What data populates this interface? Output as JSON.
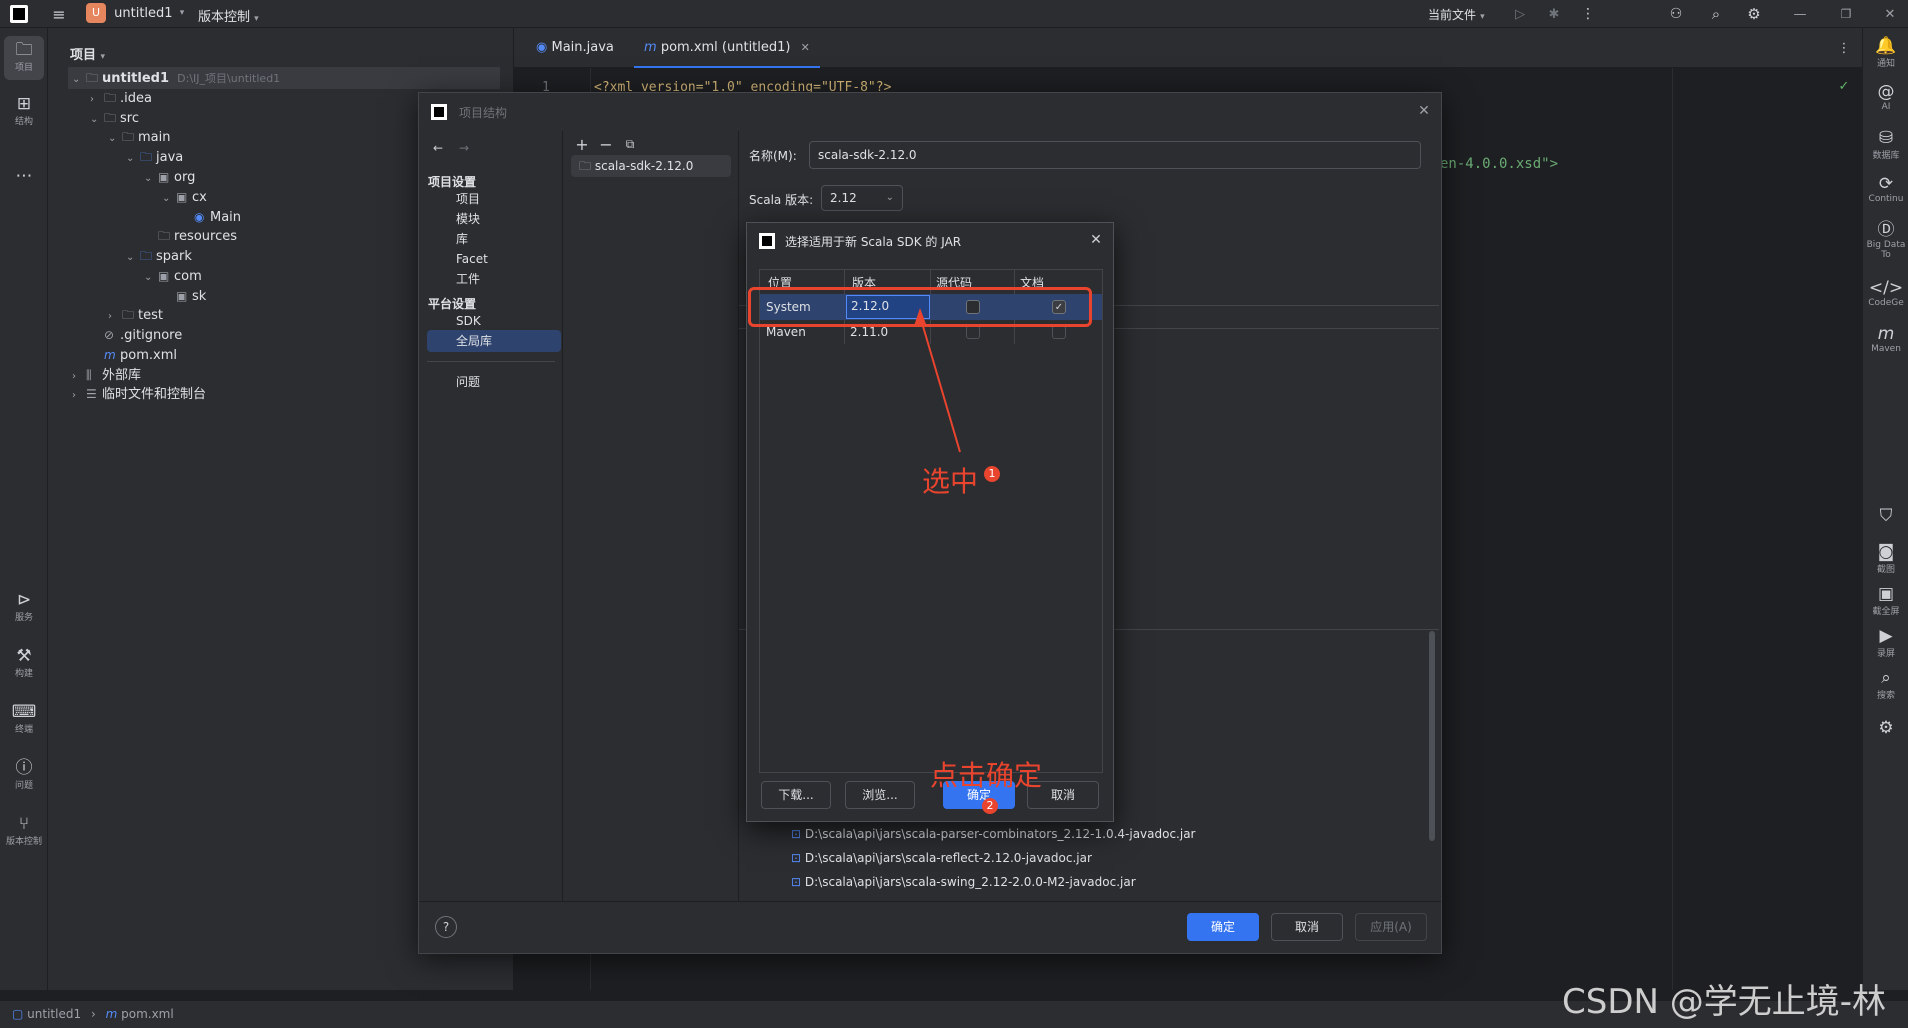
{
  "titlebar": {
    "project": "untitled1",
    "project_badge": "U",
    "vcs": "版本控制",
    "run_config": "当前文件"
  },
  "left_strip": {
    "items": [
      {
        "label": "项目",
        "icon": "folder-icon"
      },
      {
        "label": "结构",
        "icon": "structure-icon"
      },
      {
        "label": "服务",
        "icon": "services-icon"
      },
      {
        "label": "构建",
        "icon": "build-icon"
      },
      {
        "label": "终端",
        "icon": "terminal-icon"
      },
      {
        "label": "问题",
        "icon": "problems-icon"
      },
      {
        "label": "版本控制",
        "icon": "git-icon"
      }
    ]
  },
  "right_strip": {
    "items": [
      {
        "label": "通知"
      },
      {
        "label": "AI"
      },
      {
        "label": "数据库"
      },
      {
        "label": "Continu"
      },
      {
        "label": "Big Data To"
      },
      {
        "label": "CodeGe"
      },
      {
        "label": "Maven"
      },
      {
        "label": "截图"
      },
      {
        "label": "截全屏"
      },
      {
        "label": "录屏"
      },
      {
        "label": "搜索"
      }
    ]
  },
  "project_panel": {
    "title": "项目",
    "tree": [
      {
        "label": "untitled1",
        "path": "D:\\IJ_项目\\untitled1"
      },
      {
        "label": ".idea"
      },
      {
        "label": "src"
      },
      {
        "label": "main"
      },
      {
        "label": "java"
      },
      {
        "label": "org"
      },
      {
        "label": "cx"
      },
      {
        "label": "Main"
      },
      {
        "label": "resources"
      },
      {
        "label": "spark"
      },
      {
        "label": "com"
      },
      {
        "label": "sk"
      },
      {
        "label": "test"
      },
      {
        "label": ".gitignore"
      },
      {
        "label": "pom.xml"
      },
      {
        "label": "外部库"
      },
      {
        "label": "临时文件和控制台"
      }
    ]
  },
  "editor": {
    "tabs": [
      {
        "label": "Main.java"
      },
      {
        "label": "pom.xml (untitled1)"
      }
    ],
    "line1_number": "1",
    "line1_code": "<?xml version=\"1.0\" encoding=\"UTF-8\"?>",
    "code_fragment": "en-4.0.0.xsd\">"
  },
  "project_structure": {
    "title": "项目结构",
    "project_settings_header": "项目设置",
    "project_settings": [
      "项目",
      "模块",
      "库",
      "Facet",
      "工件"
    ],
    "platform_settings_header": "平台设置",
    "platform_settings": [
      "SDK",
      "全局库"
    ],
    "problems": "问题",
    "library_item": "scala-sdk-2.12.0",
    "name_label": "名称(M):",
    "name_value": "scala-sdk-2.12.0",
    "scala_version_label": "Scala 版本:",
    "scala_version_value": "2.12",
    "jars": [
      "D:\\scala\\api\\jars\\scala-parser-combinators_2.12-1.0.4-javadoc.jar",
      "D:\\scala\\api\\jars\\scala-reflect-2.12.0-javadoc.jar",
      "D:\\scala\\api\\jars\\scala-swing_2.12-2.0.0-M2-javadoc.jar"
    ],
    "help": "?",
    "ok": "确定",
    "cancel": "取消",
    "apply": "应用(A)"
  },
  "jar_dialog": {
    "title": "选择适用于新 Scala SDK 的 JAR",
    "columns": [
      "位置",
      "版本",
      "源代码",
      "文档"
    ],
    "rows": [
      {
        "location": "System",
        "version": "2.12.0",
        "sources": false,
        "docs": true
      },
      {
        "location": "Maven",
        "version": "2.11.0",
        "sources": false,
        "docs": false
      }
    ],
    "download": "下载...",
    "browse": "浏览...",
    "ok": "确定",
    "cancel": "取消"
  },
  "annotations": {
    "select_text": "选中",
    "select_badge": "1",
    "confirm_text": "点击确定",
    "confirm_badge": "2",
    "color": "#e8442e"
  },
  "statusbar": {
    "project": "untitled1",
    "file": "pom.xml"
  },
  "watermark": "CSDN @学无止境-林",
  "colors": {
    "accent": "#3574f0",
    "annotation": "#e8442e"
  }
}
